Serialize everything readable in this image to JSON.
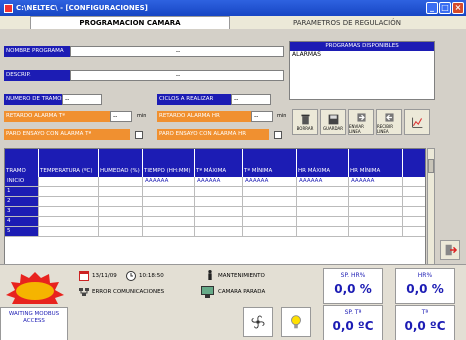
{
  "window": {
    "title": "C:\\NELTEC\\ - [CONFIGURACIONES]"
  },
  "tabs": [
    {
      "label": "PROGRAMACION CAMARA"
    },
    {
      "label": "PARAMETROS DE REGULACIÓN"
    }
  ],
  "form": {
    "nombre_label": "NOMBRE PROGRAMA",
    "nombre_value": "--",
    "descrip_label": "DESCRIP.",
    "descrip_value": "--",
    "tramos_label": "NUMERO DE TRAMOS",
    "tramos_value": "--",
    "ciclos_label": "CICLOS A REALIZAR",
    "ciclos_value": "--",
    "retardo_temp_label": "RETARDO ALARMA Tª",
    "retardo_temp_value": "--",
    "retardo_temp_unit": "min",
    "retardo_hr_label": "RETARDO ALARMA HR",
    "retardo_hr_value": "--",
    "retardo_hr_unit": "min",
    "paro_temp_label": "PARO ENSAYO CON ALARMA Tª",
    "paro_hr_label": "PARO ENSAYO CON ALARMA HR"
  },
  "programs": {
    "title": "PROGRAMAS DISPONIBLES",
    "items": [
      "ALARMAS"
    ]
  },
  "toolbar": [
    {
      "label": "BORRAR"
    },
    {
      "label": "GUARDAR"
    },
    {
      "label": "ENVIAR LINEA"
    },
    {
      "label": "RECIBIR LINEA"
    },
    {
      "label": ""
    }
  ],
  "grid": {
    "columns": [
      "TRAMO",
      "TEMPERATURA (ºC)",
      "HUMEDAD (%)",
      "TIEMPO (HH:MM)",
      "Tª MÁXIMA",
      "Tª MÍNIMA",
      "HR MÁXIMA",
      "HR MÍNIMA"
    ],
    "rows": [
      {
        "label": "INICIO",
        "cells": [
          "",
          "",
          "AAAAAA",
          "AAAAAA",
          "AAAAAA",
          "AAAAAA",
          "AAAAAA"
        ]
      },
      {
        "label": "1",
        "cells": [
          "",
          "",
          "",
          "",
          "",
          "",
          ""
        ]
      },
      {
        "label": "2",
        "cells": [
          "",
          "",
          "",
          "",
          "",
          "",
          ""
        ]
      },
      {
        "label": "3",
        "cells": [
          "",
          "",
          "",
          "",
          "",
          "",
          ""
        ]
      },
      {
        "label": "4",
        "cells": [
          "",
          "",
          "",
          "",
          "",
          "",
          ""
        ]
      },
      {
        "label": "5",
        "cells": [
          "",
          "",
          "",
          "",
          "",
          "",
          ""
        ]
      }
    ]
  },
  "status": {
    "date": "13/11/09",
    "time": "10:18:50",
    "maint": "MANTENIMIENTO",
    "comms": "ERROR COMUNICACIONES",
    "chamber": "CAMARA PARADA",
    "waiting": "WAITING MODBUS ACCESS"
  },
  "measurements": [
    {
      "label": "SP. HR%",
      "value": "0,0 %"
    },
    {
      "label": "HR%",
      "value": "0,0 %"
    },
    {
      "label": "SP. Tª",
      "value": "0,0 ºC"
    },
    {
      "label": "Tª",
      "value": "0,0 ºC"
    }
  ],
  "colors": {
    "accent": "#1c1cb4",
    "alarm": "#f09030",
    "titlebar": "#1f52d0"
  }
}
